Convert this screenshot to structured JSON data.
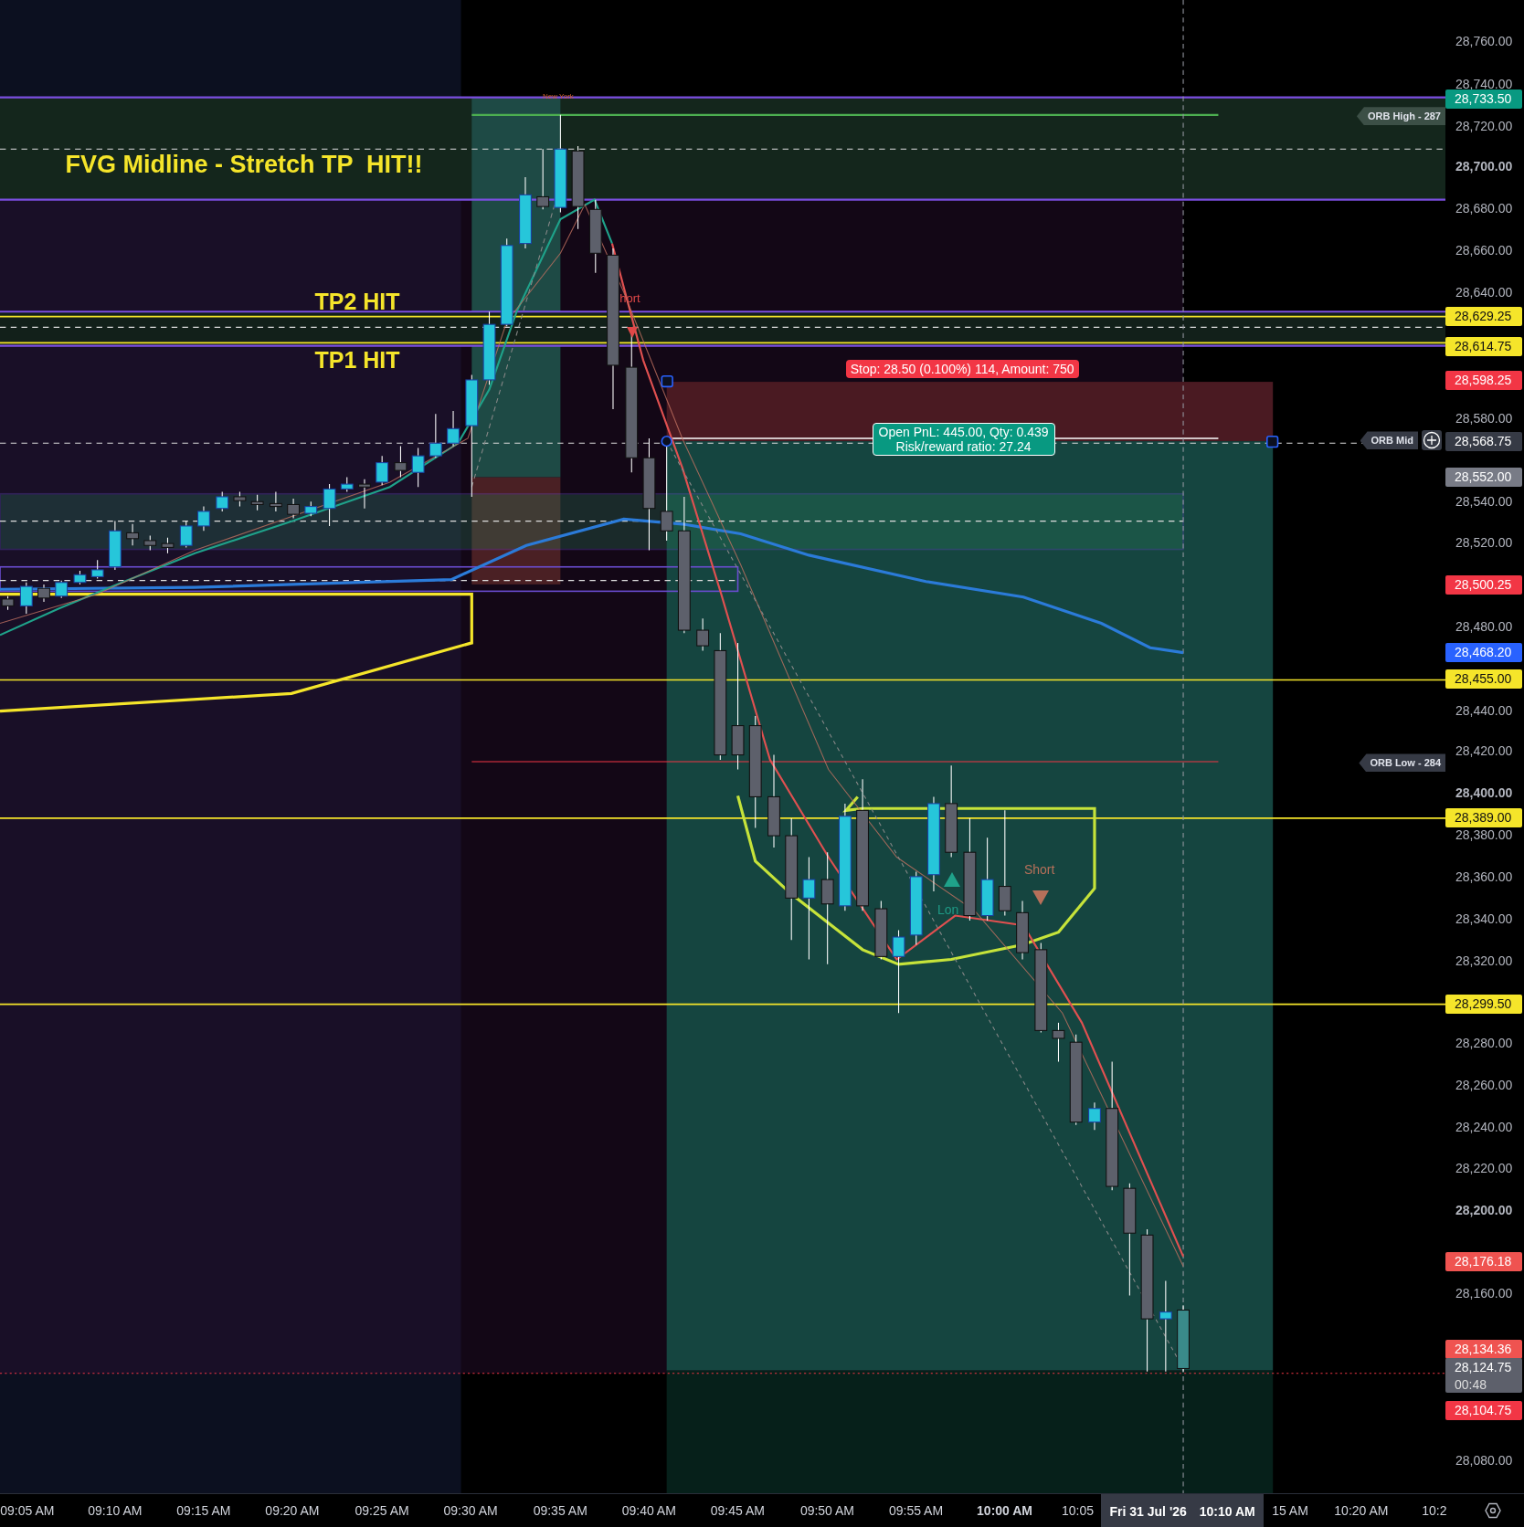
{
  "chart": {
    "session_label": "New York",
    "annotations": [
      {
        "kind": "headline",
        "text": "FVG Midline - Stretch TP  HIT!!"
      },
      {
        "kind": "target",
        "text": "TP2 HIT"
      },
      {
        "kind": "target",
        "text": "TP1 HIT"
      }
    ],
    "signals": [
      {
        "kind": "short",
        "label": "hort"
      },
      {
        "kind": "short",
        "label": "Short"
      },
      {
        "kind": "long",
        "label": "Lon"
      }
    ],
    "position": {
      "stop_label": "Stop: 28.50 (0.100%) 114, Amount: 750",
      "pnl_label": "Open PnL: 445.00, Qty: 0.439",
      "ratio_label": "Risk/reward ratio: 27.24"
    },
    "line_tags": [
      {
        "label": "ORB High - 287",
        "kind": "plain"
      },
      {
        "label": "ORB Mid",
        "kind": "add"
      },
      {
        "label": "ORB Low - 284",
        "kind": "plain"
      }
    ]
  },
  "price_axis": {
    "ticks": [
      {
        "label": "28,760.00",
        "bold": false
      },
      {
        "label": "28,740.00",
        "bold": false
      },
      {
        "label": "28,720.00",
        "bold": false
      },
      {
        "label": "28,700.00",
        "bold": true
      },
      {
        "label": "28,680.00",
        "bold": false
      },
      {
        "label": "28,660.00",
        "bold": false
      },
      {
        "label": "28,640.00",
        "bold": false
      },
      {
        "label": "28,580.00",
        "bold": false
      },
      {
        "label": "28,540.00",
        "bold": false
      },
      {
        "label": "28,520.00",
        "bold": false
      },
      {
        "label": "28,480.00",
        "bold": false
      },
      {
        "label": "28,440.00",
        "bold": false
      },
      {
        "label": "28,420.00",
        "bold": false
      },
      {
        "label": "28,400.00",
        "bold": true
      },
      {
        "label": "28,380.00",
        "bold": false
      },
      {
        "label": "28,360.00",
        "bold": false
      },
      {
        "label": "28,340.00",
        "bold": false
      },
      {
        "label": "28,320.00",
        "bold": false
      },
      {
        "label": "28,280.00",
        "bold": false
      },
      {
        "label": "28,260.00",
        "bold": false
      },
      {
        "label": "28,240.00",
        "bold": false
      },
      {
        "label": "28,220.00",
        "bold": false
      },
      {
        "label": "28,200.00",
        "bold": true
      },
      {
        "label": "28,160.00",
        "bold": false
      },
      {
        "label": "28,080.00",
        "bold": false
      }
    ],
    "badges": [
      {
        "label": "28,733.50",
        "color": "#089981"
      },
      {
        "label": "28,629.25",
        "color": "#f5e52a"
      },
      {
        "label": "28,614.75",
        "color": "#f5e52a"
      },
      {
        "label": "28,598.25",
        "color": "#f23645"
      },
      {
        "label": "28,568.75",
        "color": "#363a45"
      },
      {
        "label": "28,552.00",
        "color": "#787b86"
      },
      {
        "label": "28,500.25",
        "color": "#f23645"
      },
      {
        "label": "28,468.20",
        "color": "#2962ff"
      },
      {
        "label": "28,455.00",
        "color": "#f5e52a"
      },
      {
        "label": "28,389.00",
        "color": "#f5e52a"
      },
      {
        "label": "28,299.50",
        "color": "#f5e52a"
      },
      {
        "label": "28,176.18",
        "color": "#ef5350"
      },
      {
        "label": "28,134.36",
        "color": "#ef5350"
      },
      {
        "label": "28,124.75",
        "sublabel": "00:48",
        "color": "#5d606b"
      },
      {
        "label": "28,104.75",
        "color": "#f23645"
      }
    ]
  },
  "time_axis": {
    "ticks": [
      {
        "label": "09:05 AM",
        "bold": false
      },
      {
        "label": "09:10 AM",
        "bold": false
      },
      {
        "label": "09:15 AM",
        "bold": false
      },
      {
        "label": "09:20 AM",
        "bold": false
      },
      {
        "label": "09:25 AM",
        "bold": false
      },
      {
        "label": "09:30 AM",
        "bold": false
      },
      {
        "label": "09:35 AM",
        "bold": false
      },
      {
        "label": "09:40 AM",
        "bold": false
      },
      {
        "label": "09:45 AM",
        "bold": false
      },
      {
        "label": "09:50 AM",
        "bold": false
      },
      {
        "label": "09:55 AM",
        "bold": false
      },
      {
        "label": "10:00 AM",
        "bold": true
      },
      {
        "label": "10:05",
        "bold": false
      },
      {
        "label": "15 AM",
        "bold": false
      },
      {
        "label": "10:20 AM",
        "bold": false
      },
      {
        "label": "10:2",
        "bold": false
      }
    ],
    "crosshair": {
      "date": "Fri 31 Jul '26",
      "time": "10:10 AM"
    }
  }
}
